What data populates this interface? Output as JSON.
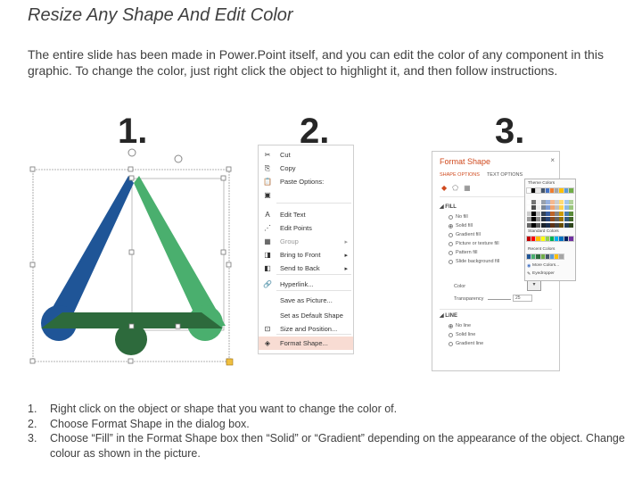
{
  "slide": {
    "title": "Resize Any Shape And Edit Color",
    "intro": "The entire slide has been made in Power.Point itself, and you can edit the color of any component in this graphic. To change the color, just right click the object to highlight it, and then follow instructions."
  },
  "step_numbers": [
    "1.",
    "2.",
    "3."
  ],
  "graphic": {
    "colors": {
      "blue": "#1f5597",
      "green": "#4aaf6e",
      "dark_green": "#2d6a3c"
    }
  },
  "context_menu": {
    "items": [
      {
        "icon": "cut-icon",
        "glyph": "✂",
        "label": "Cut",
        "arrow": false,
        "dim": false,
        "hl": false
      },
      {
        "icon": "copy-icon",
        "glyph": "⎘",
        "label": "Copy",
        "arrow": false,
        "dim": false,
        "hl": false
      },
      {
        "icon": "paste-icon",
        "glyph": "📋",
        "label": "Paste Options:",
        "arrow": false,
        "dim": false,
        "hl": false
      },
      {
        "icon": "paste-option-icon",
        "glyph": "▣",
        "label": "",
        "arrow": false,
        "dim": false,
        "hl": false
      },
      {
        "icon": "edit-text-icon",
        "glyph": "A",
        "label": "Edit Text",
        "arrow": false,
        "dim": false,
        "hl": false
      },
      {
        "icon": "edit-points-icon",
        "glyph": "⋰",
        "label": "Edit Points",
        "arrow": false,
        "dim": false,
        "hl": false
      },
      {
        "icon": "group-icon",
        "glyph": "▦",
        "label": "Group",
        "arrow": true,
        "dim": true,
        "hl": false
      },
      {
        "icon": "bring-to-front-icon",
        "glyph": "◨",
        "label": "Bring to Front",
        "arrow": true,
        "dim": false,
        "hl": false
      },
      {
        "icon": "send-to-back-icon",
        "glyph": "◧",
        "label": "Send to Back",
        "arrow": true,
        "dim": false,
        "hl": false
      },
      {
        "icon": "hyperlink-icon",
        "glyph": "🔗",
        "label": "Hyperlink...",
        "arrow": false,
        "dim": false,
        "hl": false
      },
      {
        "icon": "save-picture-icon",
        "glyph": "",
        "label": "Save as Picture...",
        "arrow": false,
        "dim": false,
        "hl": false
      },
      {
        "icon": "default-shape-icon",
        "glyph": "",
        "label": "Set as Default Shape",
        "arrow": false,
        "dim": false,
        "hl": false
      },
      {
        "icon": "size-position-icon",
        "glyph": "⊡",
        "label": "Size and Position...",
        "arrow": false,
        "dim": false,
        "hl": false
      },
      {
        "icon": "format-shape-icon",
        "glyph": "◈",
        "label": "Format Shape...",
        "arrow": false,
        "dim": false,
        "hl": true
      }
    ]
  },
  "format_pane": {
    "title": "Format Shape",
    "close": "×",
    "tabs": [
      "SHAPE OPTIONS",
      "TEXT OPTIONS"
    ],
    "fill_header": "FILL",
    "fill_options": [
      {
        "label": "No fill",
        "selected": false
      },
      {
        "label": "Solid fill",
        "selected": true
      },
      {
        "label": "Gradient fill",
        "selected": false
      },
      {
        "label": "Picture or texture fill",
        "selected": false
      },
      {
        "label": "Pattern fill",
        "selected": false
      },
      {
        "label": "Slide background fill",
        "selected": false
      }
    ],
    "color_label": "Color",
    "transparency_label": "Transparency",
    "transparency_value": "25",
    "line_header": "LINE",
    "line_options": [
      {
        "label": "No line",
        "selected": true
      },
      {
        "label": "Solid line",
        "selected": false
      },
      {
        "label": "Gradient line",
        "selected": false
      }
    ]
  },
  "color_popup": {
    "theme_label": "Theme Colors",
    "standard_label": "Standard Colors",
    "recent_label": "Recent Colors",
    "more_colors": "More Colors...",
    "eyedropper": "Eyedropper",
    "theme_top": [
      "#ffffff",
      "#000000",
      "#e7e6e6",
      "#44546a",
      "#4472c4",
      "#ed7d31",
      "#a5a5a5",
      "#ffc000",
      "#5b9bd5",
      "#70ad47"
    ],
    "standard": [
      "#c00000",
      "#ff0000",
      "#ffc000",
      "#ffff00",
      "#92d050",
      "#00b050",
      "#00b0f0",
      "#0070c0",
      "#002060",
      "#7030a0"
    ],
    "recent": [
      "#1f5597",
      "#4aaf6e",
      "#2d6a3c",
      "#70ad47",
      "#44546a",
      "#5b9bd5",
      "#ffc000",
      "#a5a5a5"
    ]
  },
  "steps": [
    {
      "n": "1.",
      "text": "Right click on the object or shape that you want to change the color of."
    },
    {
      "n": "2.",
      "text": "Choose Format Shape in the dialog box."
    },
    {
      "n": "3.",
      "text": "Choose “Fill” in the Format Shape box then “Solid” or “Gradient” depending on the appearance of the object. Change colour as shown in the picture."
    }
  ]
}
